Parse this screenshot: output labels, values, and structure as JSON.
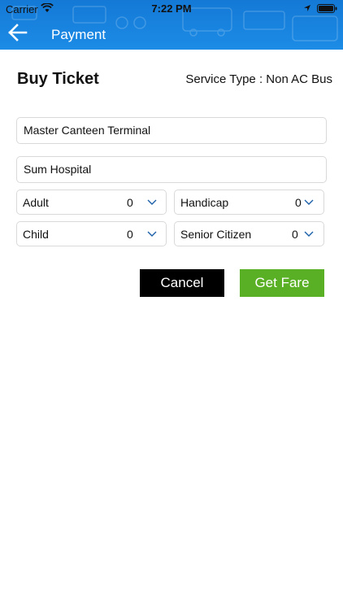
{
  "status_bar": {
    "carrier": "Carrier",
    "time": "7:22 PM"
  },
  "header": {
    "title": "Payment"
  },
  "main": {
    "heading": "Buy Ticket",
    "service_type": "Service Type : Non AC Bus",
    "from_value": "Master Canteen Terminal",
    "to_value": "Sum Hospital",
    "passengers": {
      "adult_label": "Adult",
      "adult_value": "0",
      "handicap_label": "Handicap",
      "handicap_value": "0",
      "child_label": "Child",
      "child_value": "0",
      "senior_label": "Senior Citizen",
      "senior_value": "0"
    },
    "cancel_label": "Cancel",
    "get_fare_label": "Get Fare"
  },
  "colors": {
    "header_blue": "#1a86e2",
    "get_fare_green": "#5ab025",
    "cancel_black": "#000000"
  },
  "icons": [
    "wifi-icon",
    "location-icon",
    "battery-icon",
    "back-arrow-icon",
    "chevron-down-icon"
  ]
}
